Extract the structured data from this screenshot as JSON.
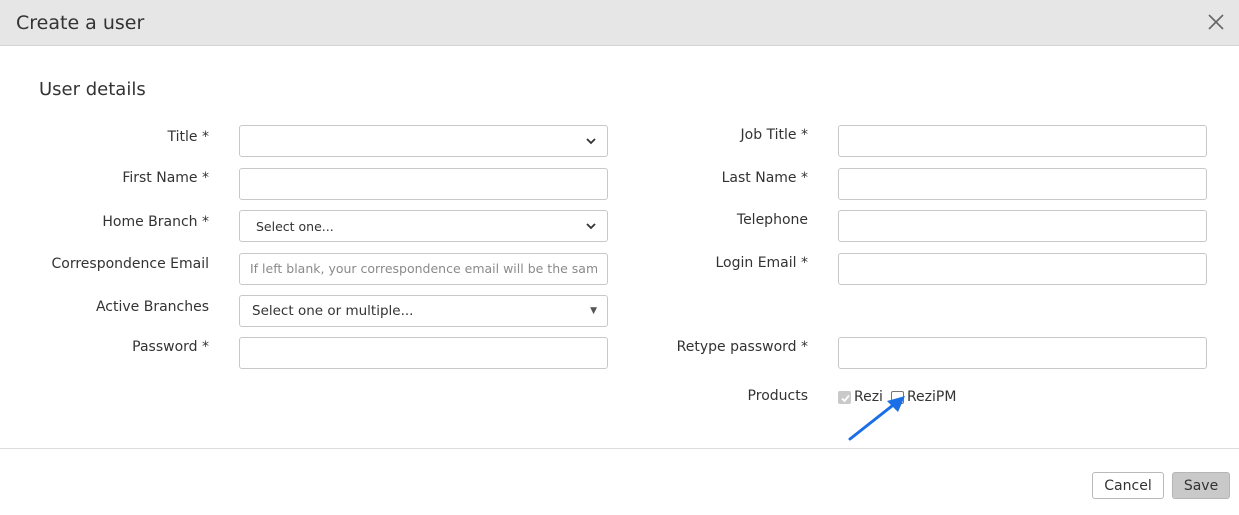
{
  "dialog": {
    "title": "Create a user",
    "close_icon": "close-icon"
  },
  "section": {
    "title": "User details"
  },
  "fields": {
    "title": {
      "label": "Title *",
      "value": ""
    },
    "first_name": {
      "label": "First Name *",
      "value": ""
    },
    "home_branch": {
      "label": "Home Branch *",
      "value": "Select one..."
    },
    "correspondence_email": {
      "label": "Correspondence Email",
      "placeholder": "If left blank, your correspondence email will be the same a"
    },
    "active_branches": {
      "label": "Active Branches",
      "value": "Select one or multiple..."
    },
    "password": {
      "label": "Password *",
      "value": ""
    },
    "job_title": {
      "label": "Job Title *",
      "value": ""
    },
    "last_name": {
      "label": "Last Name *",
      "value": ""
    },
    "telephone": {
      "label": "Telephone",
      "value": ""
    },
    "login_email": {
      "label": "Login Email *",
      "value": ""
    },
    "retype_password": {
      "label": "Retype password *",
      "value": ""
    }
  },
  "products": {
    "label": "Products",
    "options": [
      {
        "label": "Rezi",
        "checked": true,
        "disabled": true
      },
      {
        "label": "ReziPM",
        "checked": false,
        "disabled": false
      }
    ]
  },
  "annotation": {
    "arrow_color": "#1a6fe6"
  },
  "footer": {
    "cancel_label": "Cancel",
    "save_label": "Save"
  }
}
